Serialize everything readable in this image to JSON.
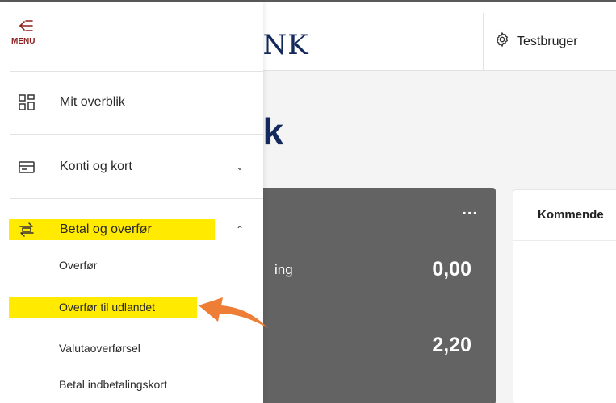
{
  "header": {
    "logo_fragment": "ANK",
    "user_label": "Testbruger",
    "settings_icon": "gear-icon"
  },
  "main": {
    "title_fragment": "lik",
    "dark_card": {
      "menu_dots": "...",
      "rows": [
        {
          "label_fragment": "ing",
          "amount": "0,00"
        },
        {
          "label_fragment": "",
          "amount": "2,20"
        }
      ]
    },
    "upcoming_card": {
      "title_fragment": "Kommende"
    }
  },
  "menu": {
    "toggle_label": "MENU",
    "toggle_icon": "menu-back-arrow-icon",
    "items": [
      {
        "label": "Mit overblik",
        "icon": "overview-grid-icon"
      },
      {
        "label": "Konti og kort",
        "icon": "card-icon",
        "chevron": "⌄"
      },
      {
        "label": "Betal og overfør",
        "icon": "transfer-arrows-icon",
        "chevron": "⌃"
      }
    ],
    "sub_items": [
      "Overfør",
      "Overfør til udlandet",
      "Valutaoverførsel",
      "Betal indbetalingskort"
    ]
  },
  "colors": {
    "highlight": "#ffea00",
    "menu_accent": "#8e1f1f",
    "brand_navy": "#152a5c",
    "annotation_arrow": "#ee7d36",
    "dark_card": "#636363"
  }
}
